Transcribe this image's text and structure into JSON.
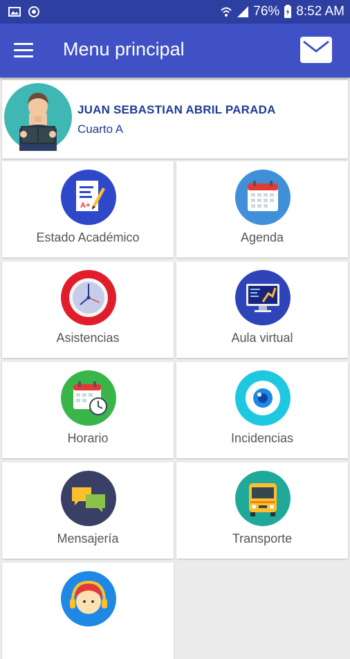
{
  "status_bar": {
    "battery": "76%",
    "time": "8:52 AM"
  },
  "app_bar": {
    "title": "Menu principal"
  },
  "student": {
    "name": "JUAN SEBASTIAN  ABRIL PARADA",
    "grade": "Cuarto A"
  },
  "menu": {
    "academic": "Estado Académico",
    "agenda": "Agenda",
    "attendance": "Asistencias",
    "virtual_classroom": "Aula virtual",
    "schedule": "Horario",
    "incidents": "Incidencias",
    "messaging": "Mensajería",
    "transport": "Transporte"
  },
  "colors": {
    "primary": "#3f51c4",
    "status_bar": "#2d3fa0",
    "accent_text": "#1f3a93"
  },
  "icons": [
    "menu-icon",
    "mail-icon",
    "report-card-icon",
    "calendar-icon",
    "clock-icon",
    "monitor-icon",
    "schedule-calendar-icon",
    "eye-icon",
    "chat-bubbles-icon",
    "bus-icon",
    "support-headset-icon"
  ]
}
